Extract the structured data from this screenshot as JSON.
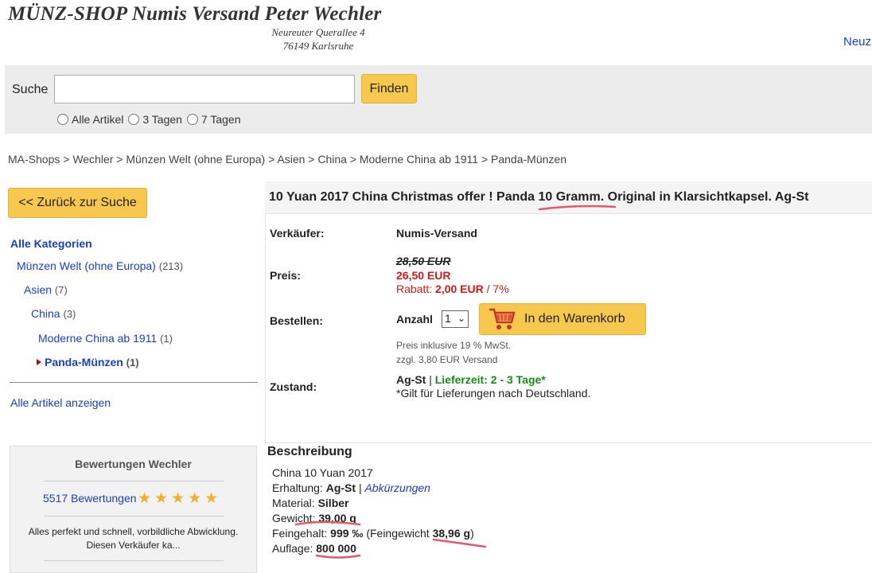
{
  "header": {
    "title": "MÜNZ-SHOP Numis Versand Peter Wechler",
    "address_line1": "Neureuter Querallee 4",
    "address_line2": "76149 Karlsruhe",
    "right_link": "Neuz"
  },
  "search": {
    "label": "Suche",
    "value": "",
    "placeholder": "",
    "button": "Finden",
    "options": [
      "Alle Artikel",
      "3 Tagen",
      "7 Tagen"
    ]
  },
  "breadcrumb": "MA-Shops > Wechler > Münzen Welt (ohne Europa) > Asien > China > Moderne China ab 1911 > Panda-Münzen",
  "sidebar": {
    "back_button": "<< Zurück zur Suche",
    "all_categories": "Alle Kategorien",
    "categories": [
      {
        "label": "Münzen Welt (ohne Europa)",
        "count": "(213)"
      },
      {
        "label": "Asien",
        "count": "(7)"
      },
      {
        "label": "China",
        "count": "(3)"
      },
      {
        "label": "Moderne China ab 1911",
        "count": "(1)"
      },
      {
        "label": "Panda-Münzen",
        "count": "(1)"
      }
    ],
    "all_items": "Alle Artikel anzeigen",
    "rating": {
      "title": "Bewertungen Wechler",
      "count": "5517 Bewertungen",
      "stars": 5,
      "text_line1": "Alles perfekt und schnell, vorbildliche Abwicklung.",
      "text_line2": "Diesen Verkäufer ka..."
    }
  },
  "product": {
    "title": "10 Yuan 2017 China Christmas offer ! Panda 10 Gramm. Original in Klarsichtkapsel. Ag-St",
    "seller_label": "Verkäufer:",
    "seller": "Numis-Versand",
    "price_label": "Preis:",
    "old_price": "28,50 EUR",
    "new_price": "26,50 EUR",
    "discount_label": "Rabatt:",
    "discount_amount": "2,00 EUR",
    "discount_percent": "/ 7%",
    "order_label": "Bestellen:",
    "qty_label": "Anzahl",
    "qty_value": "1",
    "cart_button": "In den Warenkorb",
    "vat_note": "Preis inklusive 19 % MwSt.",
    "shipping_note": "zzgl. 3,80 EUR Versand",
    "condition_label": "Zustand:",
    "condition": "Ag-St",
    "separator": "|",
    "delivery": "Lieferzeit: 2 - 3 Tage*",
    "delivery_note": "*Gilt für Lieferungen nach Deutschland."
  },
  "description": {
    "heading": "Beschreibung",
    "line1": "China 10 Yuan 2017",
    "erhaltung_label": "Erhaltung:",
    "erhaltung_value": "Ag-St",
    "erhaltung_sep": "|",
    "erhaltung_link": "Abkürzungen",
    "material_label": "Material:",
    "material_value": "Silber",
    "gewicht_label": "Gewicht:",
    "gewicht_value": "39,00 g",
    "feingehalt_label": "Feingehalt:",
    "feingehalt_value": "999 ‰",
    "feingewicht_open": "(Feingewicht",
    "feingewicht_value": "38,96 g",
    "feingewicht_close": ")",
    "auflage_label": "Auflage:",
    "auflage_value": "800 000"
  },
  "colors": {
    "accent_button": "#f7c84e",
    "link": "#1a3fbf",
    "price_red": "#d21a1a",
    "delivery_green": "#1a8a1a",
    "annotation_underline": "#e05a6a"
  }
}
